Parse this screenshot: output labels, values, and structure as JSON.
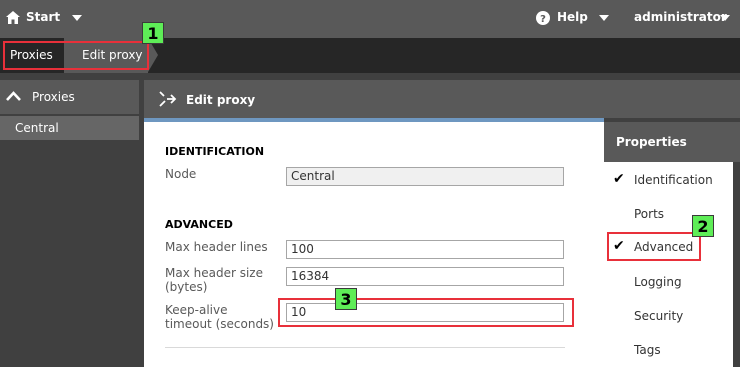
{
  "topbar": {
    "start_label": "Start",
    "help_label": "Help",
    "user_label": "administrator"
  },
  "breadcrumb": {
    "items": [
      {
        "label": "Proxies"
      },
      {
        "label": "Edit proxy"
      }
    ]
  },
  "callouts": [
    "1",
    "2",
    "3"
  ],
  "leftnav": {
    "header": "Proxies",
    "items": [
      {
        "label": "Central"
      }
    ]
  },
  "main": {
    "title": "Edit proxy",
    "sections": {
      "identification": {
        "title": "IDENTIFICATION",
        "node_label": "Node",
        "node_value": "Central"
      },
      "advanced": {
        "title": "ADVANCED",
        "max_header_lines_label": "Max header lines",
        "max_header_lines_value": "100",
        "max_header_size_label_1": "Max header size",
        "max_header_size_label_2": "(bytes)",
        "max_header_size_value": "16384",
        "keep_alive_label_1": "Keep-alive",
        "keep_alive_label_2": "timeout (seconds)",
        "keep_alive_value": "10"
      }
    }
  },
  "properties": {
    "title": "Properties",
    "items": [
      {
        "label": "Identification",
        "checked": true
      },
      {
        "label": "Ports",
        "checked": false
      },
      {
        "label": "Advanced",
        "checked": true
      },
      {
        "label": "Logging",
        "checked": false
      },
      {
        "label": "Security",
        "checked": false
      },
      {
        "label": "Tags",
        "checked": false
      }
    ]
  },
  "colors": {
    "callout_badge": "#5eed57",
    "callout_border": "#e8303a",
    "accent": "#6e97c0"
  }
}
